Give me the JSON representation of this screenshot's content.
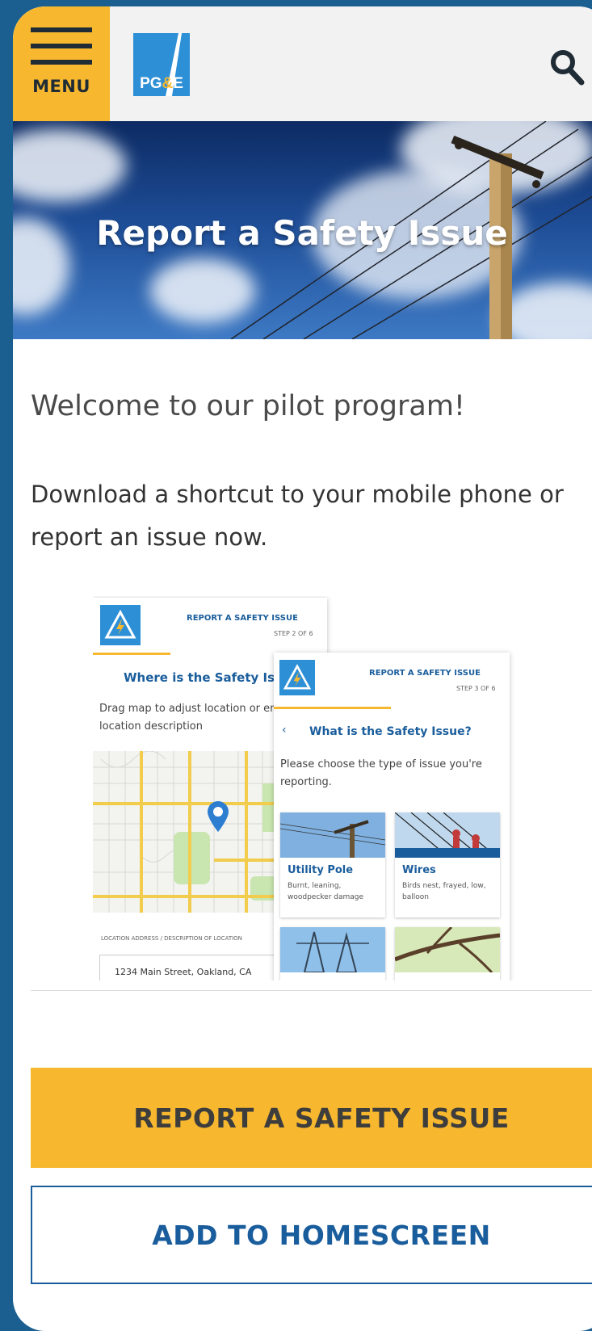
{
  "header": {
    "menu_label": "MENU",
    "logo_text_1": "PG",
    "logo_text_amp": "&",
    "logo_text_2": "E",
    "search_icon": "search-icon"
  },
  "hero": {
    "title": "Report a Safety Issue"
  },
  "content": {
    "welcome": "Welcome to our pilot program!",
    "intro": "Download a shortcut to your mobile phone or report an issue now."
  },
  "preview_step2": {
    "app_title": "REPORT A SAFETY ISSUE",
    "step": "STEP 2 OF 6",
    "question": "Where is the Safety Issue?",
    "instructions": "Drag map to adjust location or enter a location description",
    "location_label": "LOCATION ADDRESS / DESCRIPTION OF LOCATION",
    "address_value": "1234 Main Street, Oakland, CA"
  },
  "preview_step3": {
    "app_title": "REPORT A SAFETY ISSUE",
    "step": "STEP 3 OF 6",
    "back_icon": "chevron-left-icon",
    "question": "What is the Safety Issue?",
    "instructions": "Please choose the type of issue you're reporting.",
    "issue_types": [
      {
        "name": "Utility Pole",
        "description": "Burnt, leaning, woodpecker damage"
      },
      {
        "name": "Wires",
        "description": "Birds nest, frayed, low, balloon"
      }
    ]
  },
  "actions": {
    "report_label": "REPORT A SAFETY ISSUE",
    "homescreen_label": "ADD TO HOMESCREEN"
  },
  "colors": {
    "accent": "#f7b82f",
    "brand_blue": "#1a5d9c",
    "frame": "#1a5f8f"
  }
}
